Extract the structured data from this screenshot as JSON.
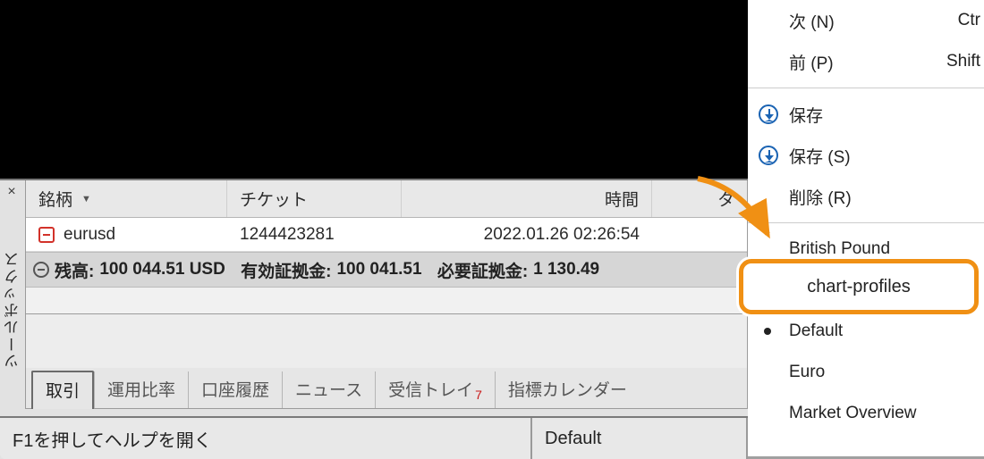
{
  "panel": {
    "close": "×",
    "vertical_label": "ツールボックス",
    "headers": {
      "symbol": "銘柄",
      "ticket": "チケット",
      "time": "時間",
      "last": "タ"
    },
    "row": {
      "symbol": "eurusd",
      "ticket": "1244423281",
      "time": "2022.01.26 02:26:54"
    },
    "summary": {
      "balance_label": "残高:",
      "balance_value": "100 044.51 USD",
      "equity_label": "有効証拠金:",
      "equity_value": "100 041.51",
      "margin_label": "必要証拠金:",
      "margin_value": "1 130.49"
    },
    "tabs": [
      "取引",
      "運用比率",
      "口座履歴",
      "ニュース",
      "受信トレイ",
      "指標カレンダー"
    ],
    "tabs_active_index": 0,
    "inbox_badge": "7"
  },
  "status": {
    "help": "F1を押してヘルプを開く",
    "profile": "Default"
  },
  "menu": {
    "items_top": [
      {
        "label": "次 (N)",
        "shortcut": "Ctr"
      },
      {
        "label": "前 (P)",
        "shortcut": "Shift"
      },
      {
        "label": "保存",
        "icon": "download"
      },
      {
        "label": "保存 (S)",
        "icon": "download"
      },
      {
        "label": "削除 (R)"
      }
    ],
    "items_bottom": [
      {
        "label": "British Pound"
      },
      {
        "label": "chart-profiles",
        "highlight": true
      },
      {
        "label": "Default",
        "bullet": true
      },
      {
        "label": "Euro"
      },
      {
        "label": "Market Overview"
      }
    ]
  },
  "highlight_label": "chart-profiles"
}
